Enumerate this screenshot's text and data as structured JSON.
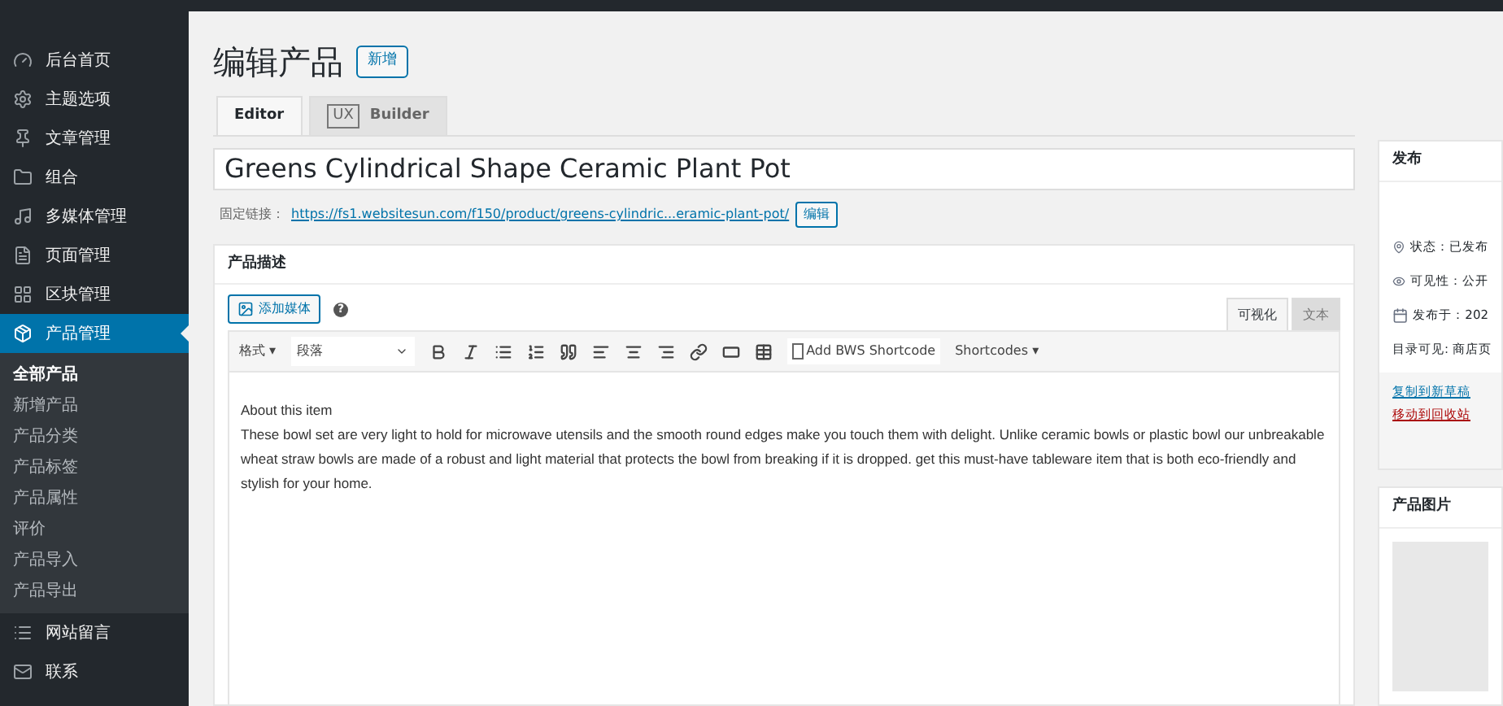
{
  "sidebar": {
    "items": [
      {
        "label": "后台首页",
        "kind": "gauge",
        "selected": false
      },
      {
        "label": "主题选项",
        "kind": "gear",
        "selected": false
      },
      {
        "label": "文章管理",
        "kind": "pin",
        "selected": false
      },
      {
        "label": "组合",
        "kind": "folder",
        "selected": false
      },
      {
        "label": "多媒体管理",
        "kind": "media",
        "selected": false
      },
      {
        "label": "页面管理",
        "kind": "page",
        "selected": false
      },
      {
        "label": "区块管理",
        "kind": "blocks",
        "selected": false
      },
      {
        "label": "产品管理",
        "kind": "box",
        "selected": true,
        "children": [
          {
            "label": "全部产品",
            "selected": true
          },
          {
            "label": "新增产品",
            "selected": false
          },
          {
            "label": "产品分类",
            "selected": false
          },
          {
            "label": "产品标签",
            "selected": false
          },
          {
            "label": "产品属性",
            "selected": false
          },
          {
            "label": "评价",
            "selected": false
          },
          {
            "label": "产品导入",
            "selected": false
          },
          {
            "label": "产品导出",
            "selected": false
          }
        ]
      },
      {
        "label": "网站留言",
        "kind": "list",
        "selected": false
      },
      {
        "label": "联系",
        "kind": "mail",
        "selected": false
      }
    ]
  },
  "page": {
    "title": "编辑产品",
    "add_button": "新增"
  },
  "editor_tabs": [
    {
      "label": "Editor",
      "selected": true
    },
    {
      "badge": "UX",
      "label": "Builder",
      "selected": false
    }
  ],
  "product_title": "Greens Cylindrical Shape Ceramic Plant Pot",
  "permalink": {
    "label": "固定链接：",
    "url": "https://fs1.websitesun.com/f150/product/greens-cylindric...eramic-plant-pot/",
    "edit_button": "编辑"
  },
  "description": {
    "heading": "产品描述",
    "add_media": "添加媒体",
    "help": "?",
    "mode_tabs": [
      {
        "label": "可视化",
        "selected": true
      },
      {
        "label": "文本",
        "selected": false
      }
    ],
    "format_menu": "格式 ▾",
    "paragraph_select": "段落",
    "bws_shortcode": "Add BWS Shortcode",
    "shortcodes_menu": "Shortcodes ▾",
    "content": [
      "About this item",
      "These bowl set are very light to hold for microwave utensils and the smooth round edges make you touch them with delight. Unlike ceramic bowls or plastic bowl our unbreakable wheat straw bowls are made of a robust and light material that protects the bowl from breaking if it is dropped. get this must-have tableware item that is both eco-friendly and stylish for your home."
    ]
  },
  "publish": {
    "heading": "发布",
    "rows": [
      {
        "kind": "pin",
        "text": "状态：已发布"
      },
      {
        "kind": "eye",
        "text": "可见性：公开"
      },
      {
        "kind": "calendar",
        "text": "发布于：202"
      },
      {
        "kind": "plain",
        "text": "目录可见: 商店页"
      }
    ],
    "copy_link": "复制到新草稿",
    "trash_link": "移动到回收站"
  },
  "product_image": {
    "heading": "产品图片"
  }
}
